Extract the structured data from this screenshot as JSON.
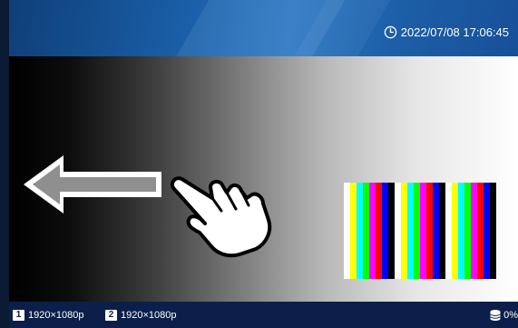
{
  "header": {
    "datetime": "2022/07/08 17:06:45",
    "clock_icon": "clock-icon"
  },
  "viewport": {
    "arrow_icon": "swipe-left-arrow-icon",
    "hand_icon": "tap-hand-icon",
    "color_bar_colors": [
      "#ffffff",
      "#ffff00",
      "#00ffff",
      "#00ff00",
      "#ff00ff",
      "#ff0000",
      "#0000ff",
      "#000000"
    ],
    "color_bar_groups": 3
  },
  "footer": {
    "sources": [
      {
        "number": "1",
        "resolution": "1920×1080p"
      },
      {
        "number": "2",
        "resolution": "1920×1080p"
      }
    ],
    "storage_icon": "storage-icon",
    "storage_usage": "0%"
  }
}
